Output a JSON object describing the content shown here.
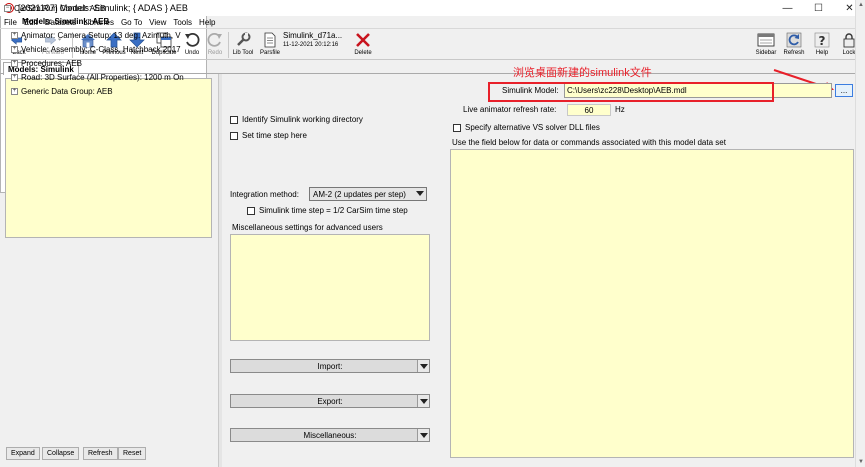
{
  "window": {
    "title": "[2021107] Models: Simulink; { ADAS } AEB",
    "controls": {
      "minimize": "—",
      "maximize": "☐",
      "close": "✕"
    }
  },
  "menu": [
    "File",
    "Edit",
    "Datasets",
    "Libraries",
    "Go To",
    "View",
    "Tools",
    "Help"
  ],
  "toolbar": {
    "back": "Back",
    "forward": "Forward",
    "home": "Home",
    "previous": "Previous",
    "next": "Next",
    "duplicate": "Duplicate",
    "undo": "Undo",
    "redo": "Redo",
    "lib_tool": "Lib Tool",
    "parsfile": "Parsfile",
    "sim_name": "Simulink_d71a...",
    "sim_date": "11-12-2021 20:12:16",
    "delete": "Delete",
    "sidebar": "Sidebar",
    "refresh": "Refresh",
    "help": "Help",
    "lock": "Lock"
  },
  "tab": {
    "label": "Models: Simulink"
  },
  "tree": [
    {
      "label": "CarSim Run Control: AEB",
      "expander": "−"
    },
    {
      "label": "Models: Simulink: AEB",
      "expander": ""
    },
    {
      "label": "Animator: Camera Setup: 13 deg. Azimuth, V",
      "expander": "+"
    },
    {
      "label": "Vehicle: Assembly: C-Class, Hatchback 2017",
      "expander": "+"
    },
    {
      "label": "Procedures: AEB",
      "expander": "+"
    },
    {
      "label": "Road: 3D Surface (All Properties): 1200 m On",
      "expander": "+"
    },
    {
      "label": "Generic Data Group: AEB",
      "expander": "+"
    }
  ],
  "bottom_buttons": {
    "expand": "Expand",
    "collapse": "Collapse",
    "refresh": "Refresh",
    "reset": "Reset"
  },
  "middle": {
    "identify_dir": "Identify Simulink working directory",
    "set_time_step": "Set time step here",
    "integration_label": "Integration method:",
    "integration_value": "AM-2 (2 updates per step)",
    "time_step_half": "Simulink time step = 1/2 CarSim time step",
    "misc_label": "Miscellaneous settings for advanced users",
    "import": "Import:",
    "export": "Export:",
    "miscellaneous": "Miscellaneous:"
  },
  "right": {
    "annotation": "浏览桌面新建的simulink文件",
    "model_label": "Simulink Model:",
    "model_path": "C:\\Users\\zc228\\Desktop\\AEB.mdl",
    "browse": "...",
    "refresh_label": "Live animator refresh rate:",
    "refresh_value": "60",
    "refresh_unit": "Hz",
    "alt_solver": "Specify alternative VS solver DLL files",
    "field_hint": "Use the field below  for data or commands associated with this model data set"
  },
  "colors": {
    "yellow_field": "#ffffcc",
    "annotation_red": "#e8202a",
    "browse_border": "#3b7de0"
  }
}
